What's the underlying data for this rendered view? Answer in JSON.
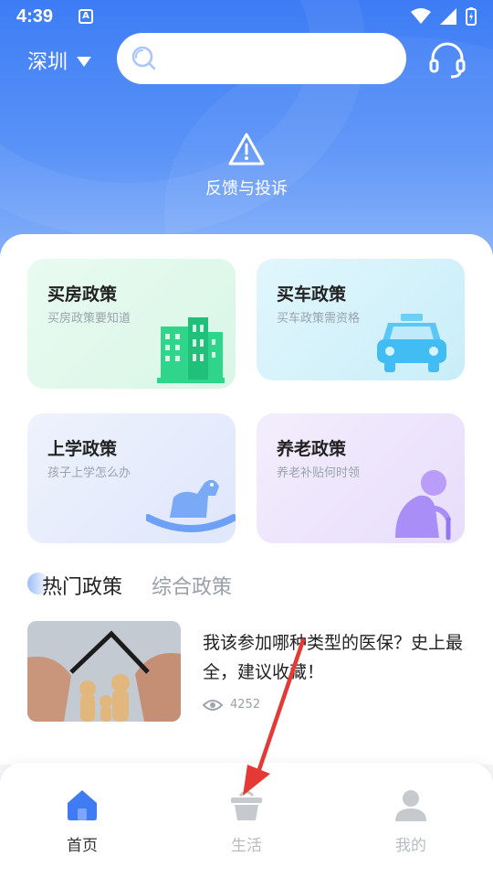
{
  "status_bar": {
    "time": "4:39",
    "notification_badge": "A"
  },
  "header": {
    "city": "深圳",
    "search_placeholder": "",
    "feedback_label": "反馈与投诉"
  },
  "policy_cards": [
    {
      "title": "买房政策",
      "subtitle": "买房政策要知道",
      "icon": "building-icon"
    },
    {
      "title": "买车政策",
      "subtitle": "买车政策需资格",
      "icon": "taxi-icon"
    },
    {
      "title": "上学政策",
      "subtitle": "孩子上学怎么办",
      "icon": "rocking-horse-icon"
    },
    {
      "title": "养老政策",
      "subtitle": "养老补贴何时领",
      "icon": "elderly-person-icon"
    }
  ],
  "tabs": [
    {
      "label": "热门政策",
      "active": true
    },
    {
      "label": "综合政策",
      "active": false
    }
  ],
  "news": [
    {
      "headline": "我该参加哪种类型的医保？史上最全，建议收藏！",
      "views": "4252",
      "image": "family-house-hands-photo"
    }
  ],
  "bottom_nav": [
    {
      "label": "首页",
      "icon": "home-icon",
      "active": true
    },
    {
      "label": "生活",
      "icon": "basket-icon",
      "active": false
    },
    {
      "label": "我的",
      "icon": "person-icon",
      "active": false
    }
  ],
  "colors": {
    "primary": "#3d7cf5",
    "nav_active": "#3f7bf3",
    "card_green": "#2fd58a",
    "card_cyan": "#4cc3f5",
    "card_blue": "#6ea0f7",
    "card_purple": "#a98ef7",
    "arrow": "#e53935"
  }
}
